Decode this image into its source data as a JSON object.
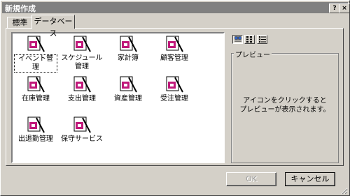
{
  "window": {
    "title": "新規作成",
    "help_label": "?",
    "close_label": "×"
  },
  "tabs": [
    {
      "label": "標準",
      "active": false
    },
    {
      "label": "データベース",
      "active": true
    }
  ],
  "templates": [
    {
      "label": "イベント管理",
      "selected": true
    },
    {
      "label": "スケジュール管理",
      "selected": false
    },
    {
      "label": "家計簿",
      "selected": false
    },
    {
      "label": "顧客管理",
      "selected": false
    },
    {
      "label": "在庫管理",
      "selected": false
    },
    {
      "label": "支出管理",
      "selected": false
    },
    {
      "label": "資産管理",
      "selected": false
    },
    {
      "label": "受注管理",
      "selected": false
    },
    {
      "label": "出退勤管理",
      "selected": false
    },
    {
      "label": "保守サービス",
      "selected": false
    }
  ],
  "view_buttons": [
    "large-icons-view",
    "list-view",
    "details-view"
  ],
  "preview": {
    "legend": "プレビュー",
    "message_line1": "アイコンをクリックすると",
    "message_line2": "プレビューが表示されます。"
  },
  "buttons": {
    "ok": "OK",
    "cancel": "キャンセル",
    "ok_enabled": false
  },
  "colors": {
    "face": "#d4d0c8",
    "title_inactive": "#808080",
    "icon_accent": "#c0187a"
  }
}
